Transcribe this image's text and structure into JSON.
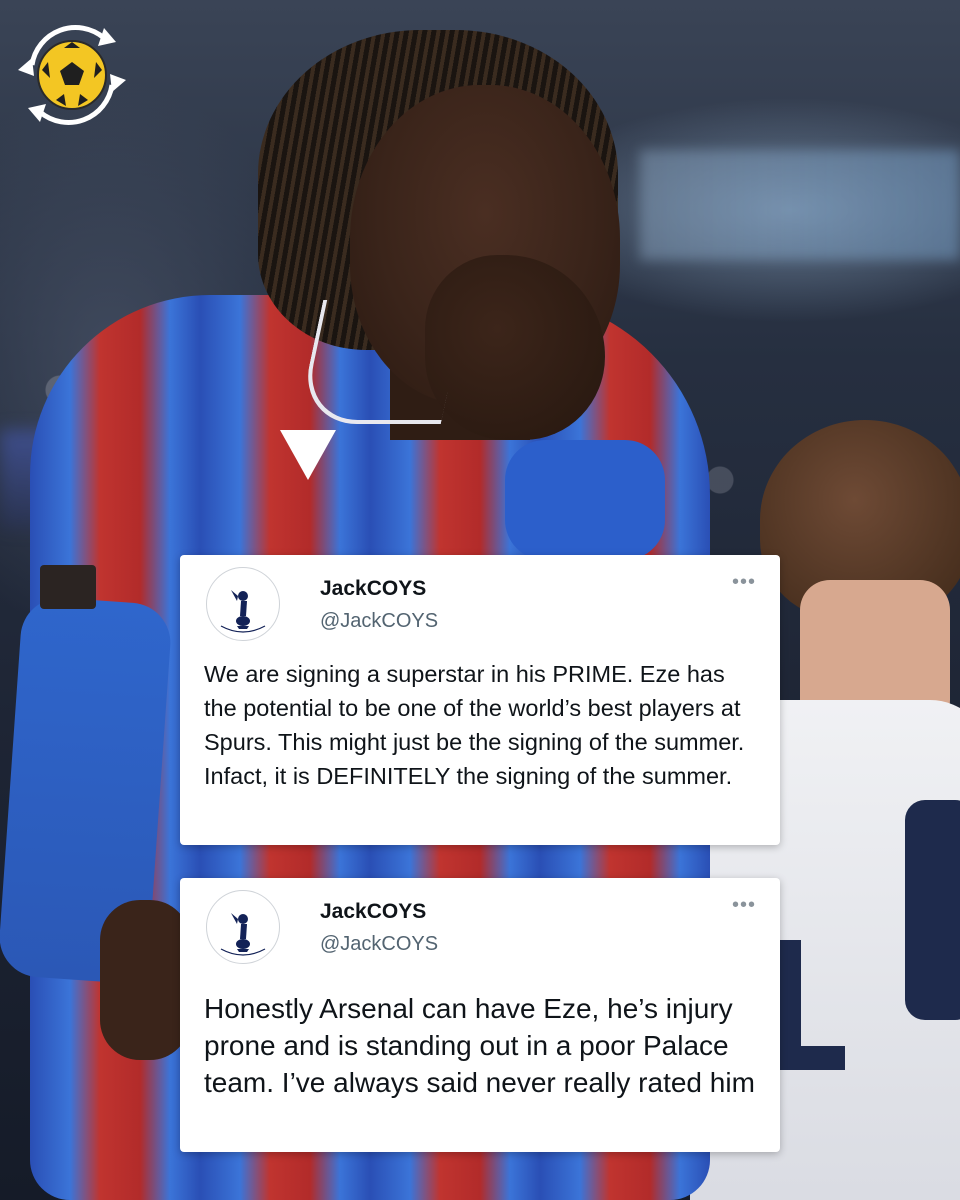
{
  "tweets": [
    {
      "name": "JackCOYS",
      "handle": "@JackCOYS",
      "text": "We are signing a superstar in his PRIME. Eze has the potential to be one of the world’s best players at Spurs. This might just be the signing of the summer. Infact, it is DEFINITELY the signing of the summer.",
      "more_icon": "•••"
    },
    {
      "name": "JackCOYS",
      "handle": "@JackCOYS",
      "text": "Honestly Arsenal can have Eze, he’s injury prone and is standing out in a poor Palace team. I’ve always said never really rated him",
      "more_icon": "•••"
    }
  ],
  "brand_logo": {
    "icon": "football-arrows-icon",
    "accent": "#f3c623"
  },
  "colors": {
    "card_bg": "#ffffff",
    "name_text": "#0f1419",
    "handle_text": "#536471",
    "kit_blue": "#2a4fb5",
    "kit_red": "#c0342f"
  }
}
